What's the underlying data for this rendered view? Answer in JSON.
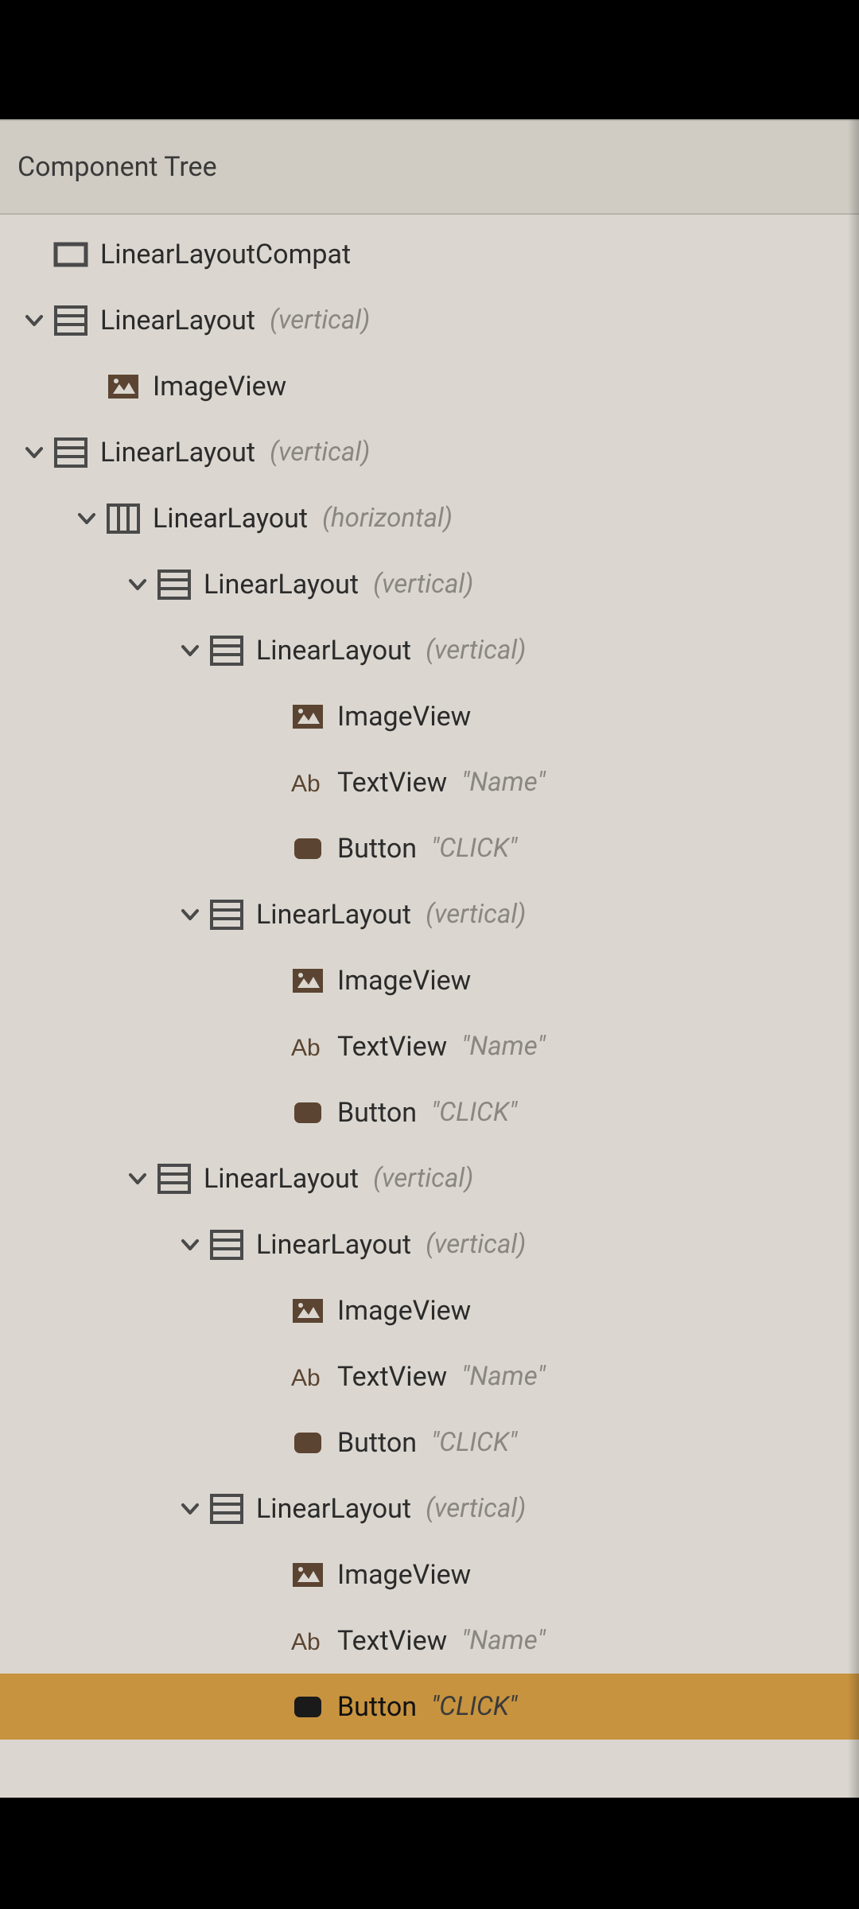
{
  "panel": {
    "title": "Component Tree"
  },
  "icons": {
    "dark": "#5b4431",
    "sel_dark": "#1a1a1a",
    "stroke": "#4a4a4a"
  },
  "tree": [
    {
      "indent": 0,
      "expander": "none",
      "icon": "rect-outline",
      "label": "LinearLayoutCompat",
      "detail": "",
      "selected": false
    },
    {
      "indent": 1,
      "expander": "open",
      "icon": "layout-vert",
      "label": "LinearLayout",
      "detail": "(vertical)",
      "selected": false
    },
    {
      "indent": 2,
      "expander": "none",
      "icon": "image",
      "label": "ImageView",
      "detail": "",
      "selected": false
    },
    {
      "indent": 1,
      "expander": "open",
      "icon": "layout-vert",
      "label": "LinearLayout",
      "detail": "(vertical)",
      "selected": false
    },
    {
      "indent": 2,
      "expander": "open",
      "icon": "layout-horiz",
      "label": "LinearLayout",
      "detail": "(horizontal)",
      "selected": false
    },
    {
      "indent": 3,
      "expander": "open",
      "icon": "layout-vert",
      "label": "LinearLayout",
      "detail": "(vertical)",
      "selected": false
    },
    {
      "indent": 4,
      "expander": "open",
      "icon": "layout-vert",
      "label": "LinearLayout",
      "detail": "(vertical)",
      "selected": false
    },
    {
      "indent": 5,
      "expander": "none",
      "icon": "image",
      "label": "ImageView",
      "detail": "",
      "selected": false
    },
    {
      "indent": 5,
      "expander": "none",
      "icon": "ab",
      "label": "TextView",
      "detail": "\"Name\"",
      "selected": false
    },
    {
      "indent": 5,
      "expander": "none",
      "icon": "button",
      "label": "Button",
      "detail": "\"CLICK\"",
      "selected": false
    },
    {
      "indent": 4,
      "expander": "open",
      "icon": "layout-vert",
      "label": "LinearLayout",
      "detail": "(vertical)",
      "selected": false
    },
    {
      "indent": 5,
      "expander": "none",
      "icon": "image",
      "label": "ImageView",
      "detail": "",
      "selected": false
    },
    {
      "indent": 5,
      "expander": "none",
      "icon": "ab",
      "label": "TextView",
      "detail": "\"Name\"",
      "selected": false
    },
    {
      "indent": 5,
      "expander": "none",
      "icon": "button",
      "label": "Button",
      "detail": "\"CLICK\"",
      "selected": false
    },
    {
      "indent": 3,
      "expander": "open",
      "icon": "layout-vert",
      "label": "LinearLayout",
      "detail": "(vertical)",
      "selected": false
    },
    {
      "indent": 4,
      "expander": "open",
      "icon": "layout-vert",
      "label": "LinearLayout",
      "detail": "(vertical)",
      "selected": false
    },
    {
      "indent": 5,
      "expander": "none",
      "icon": "image",
      "label": "ImageView",
      "detail": "",
      "selected": false
    },
    {
      "indent": 5,
      "expander": "none",
      "icon": "ab",
      "label": "TextView",
      "detail": "\"Name\"",
      "selected": false
    },
    {
      "indent": 5,
      "expander": "none",
      "icon": "button",
      "label": "Button",
      "detail": "\"CLICK\"",
      "selected": false
    },
    {
      "indent": 4,
      "expander": "open",
      "icon": "layout-vert",
      "label": "LinearLayout",
      "detail": "(vertical)",
      "selected": false
    },
    {
      "indent": 5,
      "expander": "none",
      "icon": "image",
      "label": "ImageView",
      "detail": "",
      "selected": false
    },
    {
      "indent": 5,
      "expander": "none",
      "icon": "ab",
      "label": "TextView",
      "detail": "\"Name\"",
      "selected": false
    },
    {
      "indent": 5,
      "expander": "none",
      "icon": "button",
      "label": "Button",
      "detail": "\"CLICK\"",
      "selected": true
    }
  ]
}
